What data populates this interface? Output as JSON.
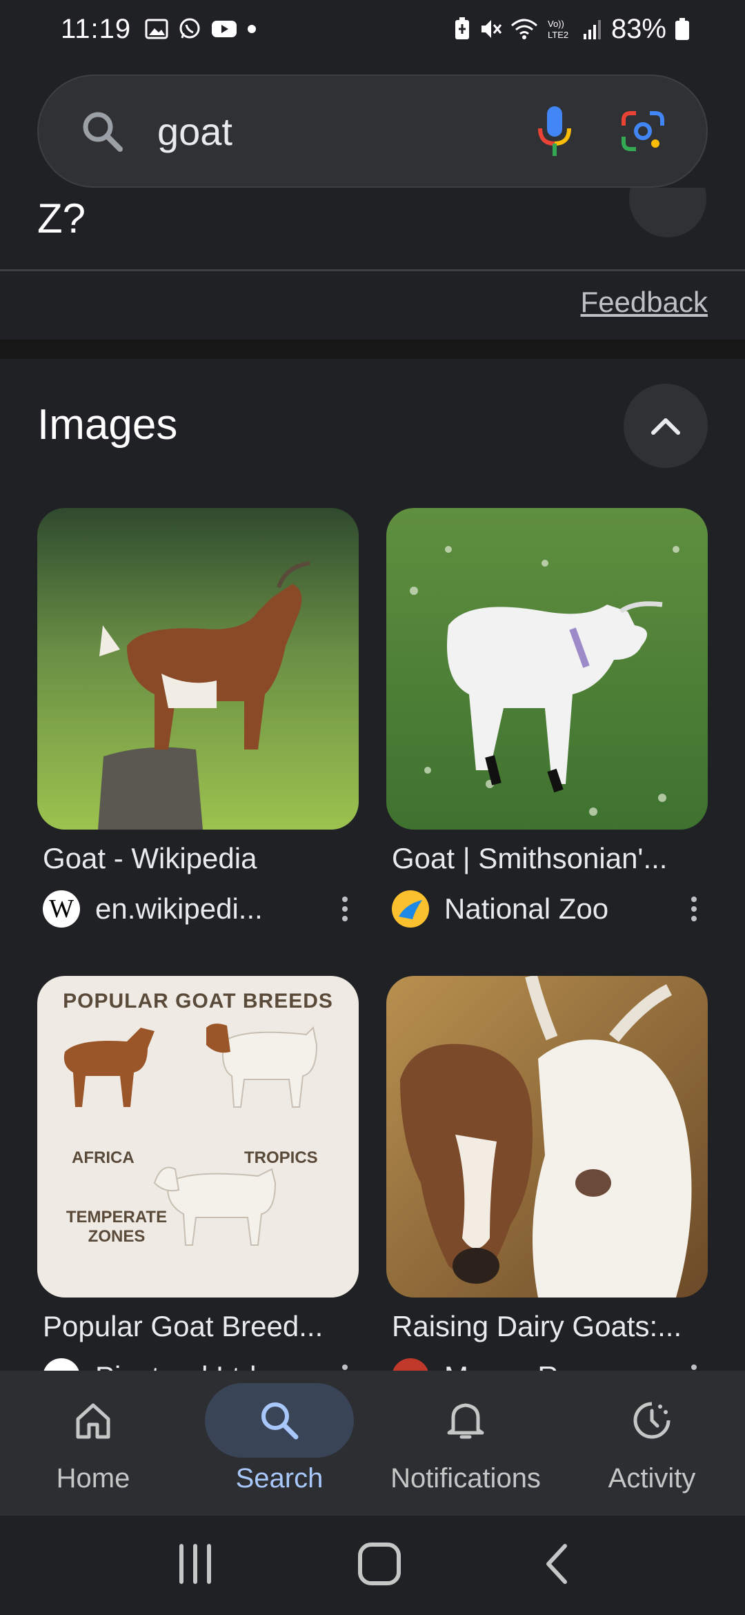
{
  "status": {
    "time": "11:19",
    "battery": "83%",
    "left_icons": [
      "gallery-icon",
      "whatsapp-icon",
      "youtube-icon",
      "dot-icon"
    ],
    "right_icons": [
      "battery-saver-icon",
      "mute-icon",
      "wifi-icon",
      "lte-icon",
      "signal-icon",
      "battery-icon"
    ]
  },
  "search": {
    "query": "goat",
    "icons": [
      "search-icon",
      "mic-icon",
      "lens-icon"
    ]
  },
  "above": {
    "cut_text": "Z?",
    "feedback_label": "Feedback"
  },
  "images": {
    "title": "Images",
    "results": [
      {
        "title": "Goat - Wikipedia",
        "source": "en.wikipedi...",
        "favicon": "wikipedia-icon"
      },
      {
        "title": "Goat | Smithsonian'...",
        "source": "National Zoo",
        "favicon": "national-zoo-icon"
      },
      {
        "title": "Popular Goat Breed...",
        "source": "Pinstand Ltd",
        "favicon": "pinstand-icon",
        "infographic": {
          "heading": "POPULAR GOAT BREEDS",
          "label_a": "AFRICA",
          "label_b": "TROPICS",
          "label_c": "TEMPERATE ZONES"
        }
      },
      {
        "title": "Raising Dairy Goats:...",
        "source": "Mosca Ro...",
        "favicon": "mosca-icon"
      }
    ]
  },
  "nav": {
    "items": [
      {
        "label": "Home",
        "icon": "home-icon",
        "active": false
      },
      {
        "label": "Search",
        "icon": "search-icon",
        "active": true
      },
      {
        "label": "Notifications",
        "icon": "bell-icon",
        "active": false
      },
      {
        "label": "Activity",
        "icon": "activity-icon",
        "active": false
      }
    ]
  },
  "colors": {
    "background": "#202124",
    "active_nav": "#a8c7fa",
    "active_pill": "#394457"
  }
}
